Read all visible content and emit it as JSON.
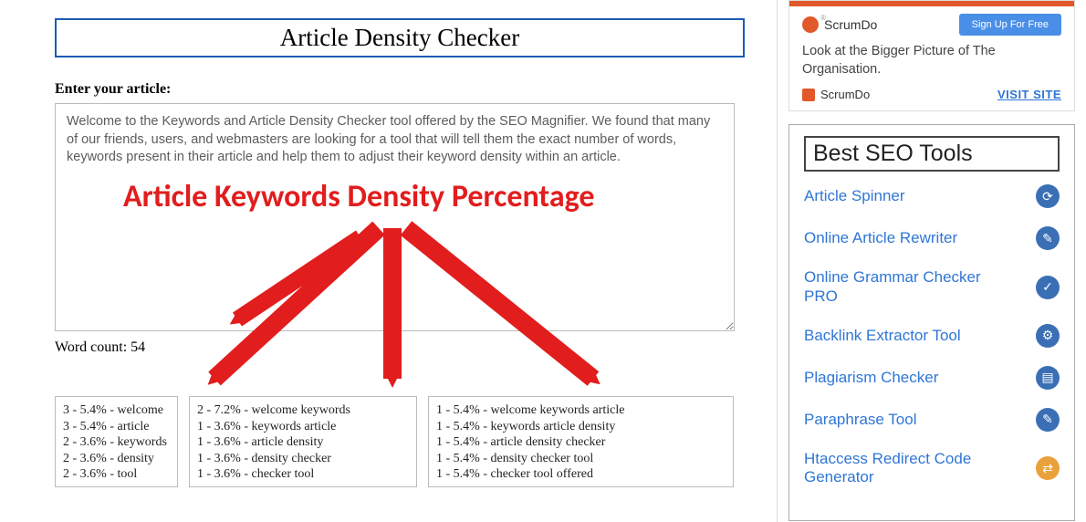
{
  "main": {
    "title": "Article Density Checker",
    "label": "Enter your article:",
    "textarea_value": "Welcome to the Keywords and Article Density Checker tool offered by the SEO Magnifier. We found that many of our friends, users, and webmasters are looking for a tool that will tell them the exact number of words, keywords present in their article and help them to adjust their keyword density within an article.",
    "word_count_label": "Word count: 54",
    "overlay_text": "Article Keywords Density Percentage",
    "results_1": [
      "3 - 5.4% - welcome",
      "3 - 5.4% - article",
      "2 - 3.6% - keywords",
      "2 - 3.6% - density",
      "2 - 3.6% - tool"
    ],
    "results_2": [
      "2 - 7.2% - welcome keywords",
      "1 - 3.6% - keywords article",
      "1 - 3.6% - article density",
      "1 - 3.6% - density checker",
      "1 - 3.6% - checker tool"
    ],
    "results_3": [
      "1 - 5.4% - welcome keywords article",
      "1 - 5.4% - keywords article density",
      "1 - 5.4% - article density checker",
      "1 - 5.4% - density checker tool",
      "1 - 5.4% - checker tool offered"
    ]
  },
  "ad": {
    "brand": "ScrumDo",
    "signup": "Sign Up For Free",
    "text": "Look at the Bigger Picture of The Organisation.",
    "footer_brand": "ScrumDo",
    "visit": "VISIT SITE"
  },
  "sidebar": {
    "heading": "Best SEO Tools",
    "tools": [
      "Article Spinner",
      "Online Article Rewriter",
      "Online Grammar Checker PRO",
      "Backlink Extractor Tool",
      "Plagiarism Checker",
      "Paraphrase Tool",
      "Htaccess Redirect Code Generator"
    ]
  }
}
